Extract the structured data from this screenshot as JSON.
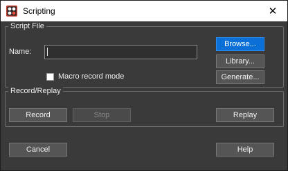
{
  "window": {
    "title": "Scripting",
    "close_symbol": "✕",
    "icon": "scripting-app-icon"
  },
  "script_file": {
    "group_title": "Script File",
    "name_label": "Name:",
    "name_value": "",
    "browse_label": "Browse...",
    "library_label": "Library...",
    "generate_label": "Generate...",
    "macro_record_label": "Macro record mode",
    "macro_record_checked": false
  },
  "record_replay": {
    "group_title": "Record/Replay",
    "record_label": "Record",
    "stop_label": "Stop",
    "replay_label": "Replay"
  },
  "footer": {
    "cancel_label": "Cancel",
    "help_label": "Help"
  },
  "colors": {
    "accent": "#0a6fd6",
    "background": "#3a3a3a"
  }
}
